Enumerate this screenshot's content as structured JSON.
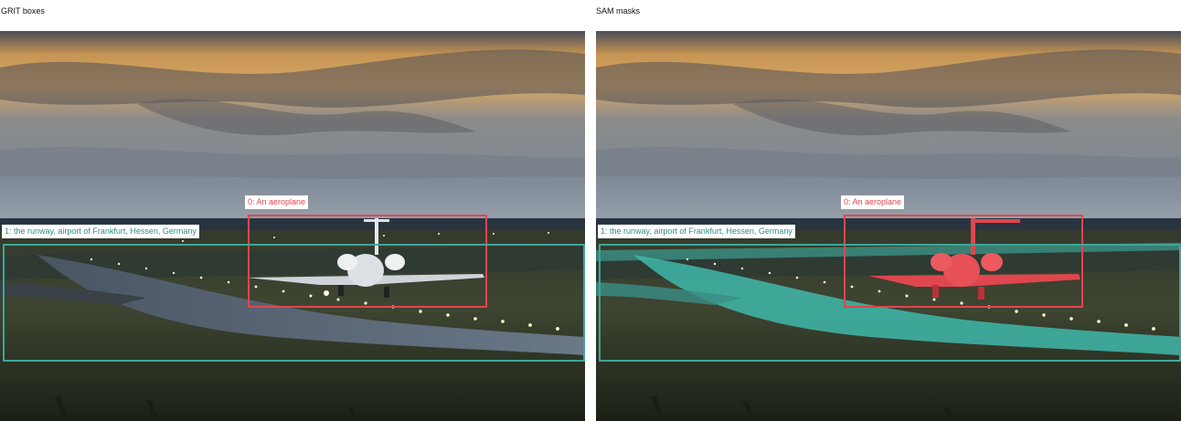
{
  "panels": [
    {
      "title": "GRIT boxes",
      "detections": [
        {
          "id": 0,
          "label": "0: An aeroplane",
          "color": "#e0464e"
        },
        {
          "id": 1,
          "label": "1: the runway, airport of Frankfurt, Hessen, Germany",
          "color": "#3aa899"
        }
      ]
    },
    {
      "title": "SAM masks",
      "detections": [
        {
          "id": 0,
          "label": "0: An aeroplane",
          "color": "#e0464e"
        },
        {
          "id": 1,
          "label": "1: the runway, airport of Frankfurt, Hessen, Germany",
          "color": "#3aa899"
        }
      ]
    }
  ],
  "colors": {
    "aeroplane": "#e0464e",
    "runway": "#3aa899",
    "sky_top": "#3d4655",
    "sky_glow": "#d9a562",
    "ground": "#2a3020"
  }
}
